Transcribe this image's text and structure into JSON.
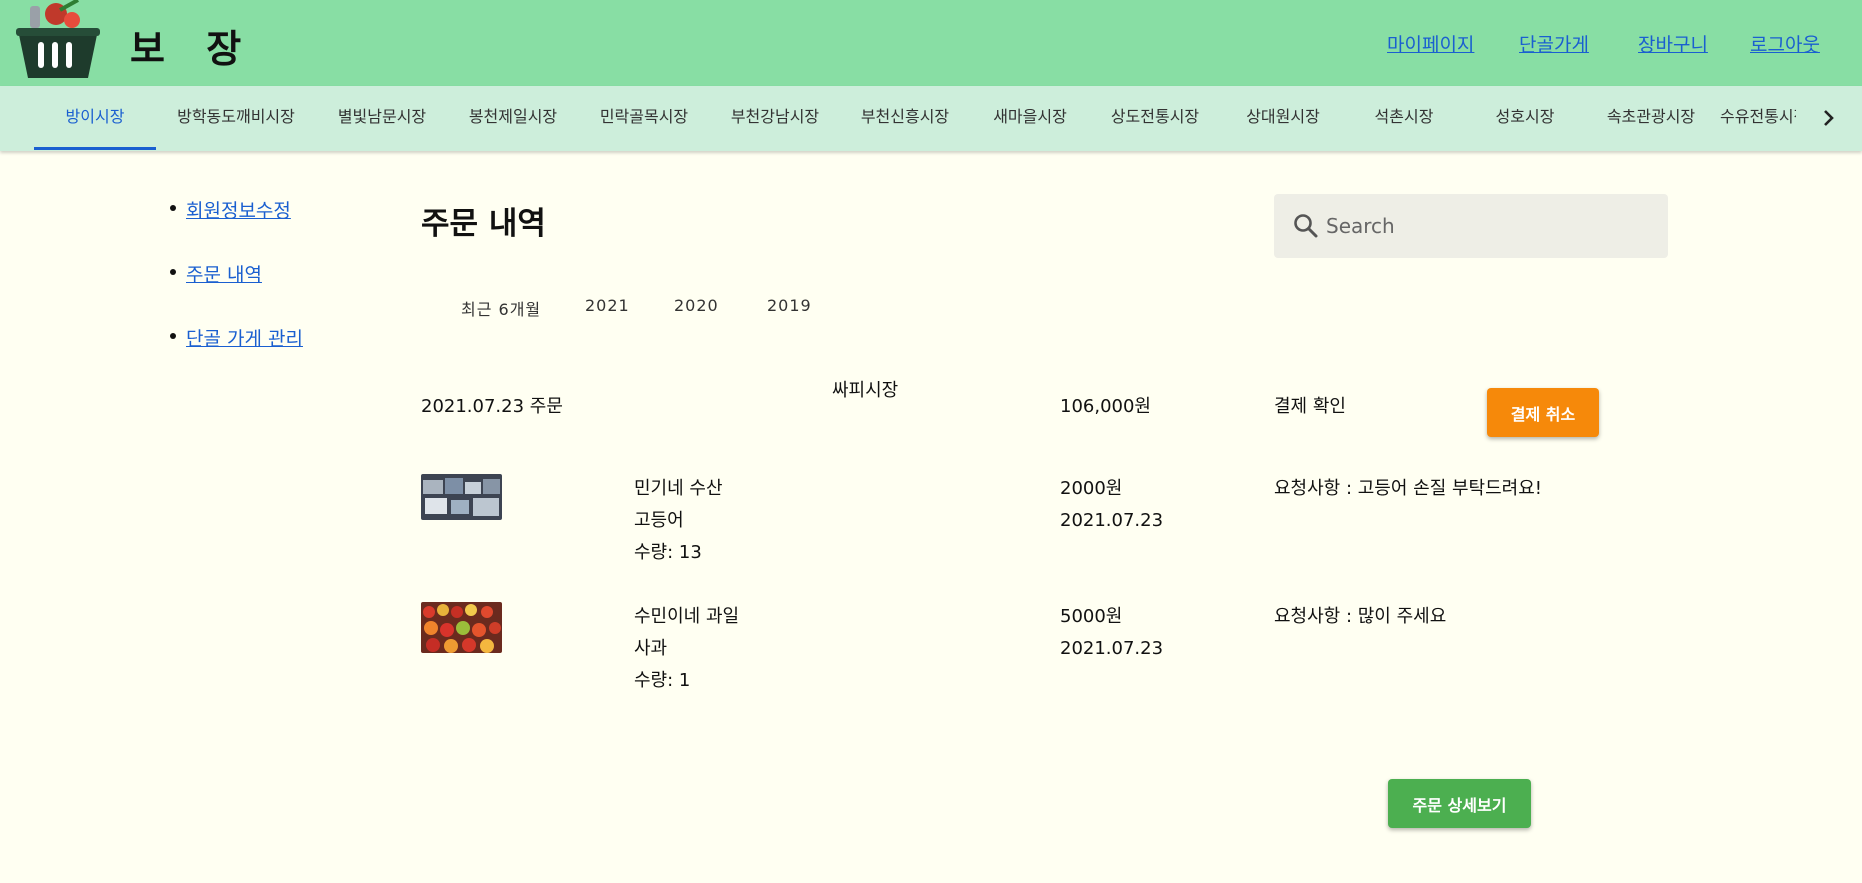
{
  "header": {
    "title": "보 장",
    "nav": [
      "마이페이지",
      "단골가게",
      "장바구니",
      "로그아웃"
    ]
  },
  "market_tabs": [
    "방이시장",
    "방학동도깨비시장",
    "별빛남문시장",
    "봉천제일시장",
    "민락골목시장",
    "부천강남시장",
    "부천신흥시장",
    "새마을시장",
    "상도전통시장",
    "상대원시장",
    "석촌시장",
    "성호시장",
    "속초관광시장",
    "수유전통시장"
  ],
  "sidebar": {
    "items": [
      "회원정보수정",
      "주문 내역",
      "단골 가게 관리"
    ]
  },
  "main": {
    "title": "주문 내역",
    "search_placeholder": "Search",
    "periods": [
      "최근 6개월",
      "2021",
      "2020",
      "2019"
    ]
  },
  "order": {
    "date_label": "2021.07.23 주문",
    "market": "싸피시장",
    "total": "106,000원",
    "status": "결제 확인",
    "cancel_label": "결제 취소",
    "detail_label": "주문 상세보기",
    "items": [
      {
        "store": "민기네 수산",
        "product": "고등어",
        "qty": "수량: 13",
        "price": "2000원",
        "date": "2021.07.23",
        "request": "요청사항 : 고등어 손질 부탁드려요!"
      },
      {
        "store": "수민이네 과일",
        "product": "사과",
        "qty": "수량: 1",
        "price": "5000원",
        "date": "2021.07.23",
        "request": "요청사항 : 많이 주세요"
      }
    ]
  },
  "colors": {
    "header_bg": "#88dea4",
    "tabs_bg": "#cdeedb",
    "page_bg": "#fffff2",
    "link": "#1a5fd0",
    "cancel_button": "#f6890a",
    "detail_button": "#4caf50"
  },
  "icons": [
    "basket-logo-icon",
    "chevron-right-icon",
    "search-icon"
  ]
}
